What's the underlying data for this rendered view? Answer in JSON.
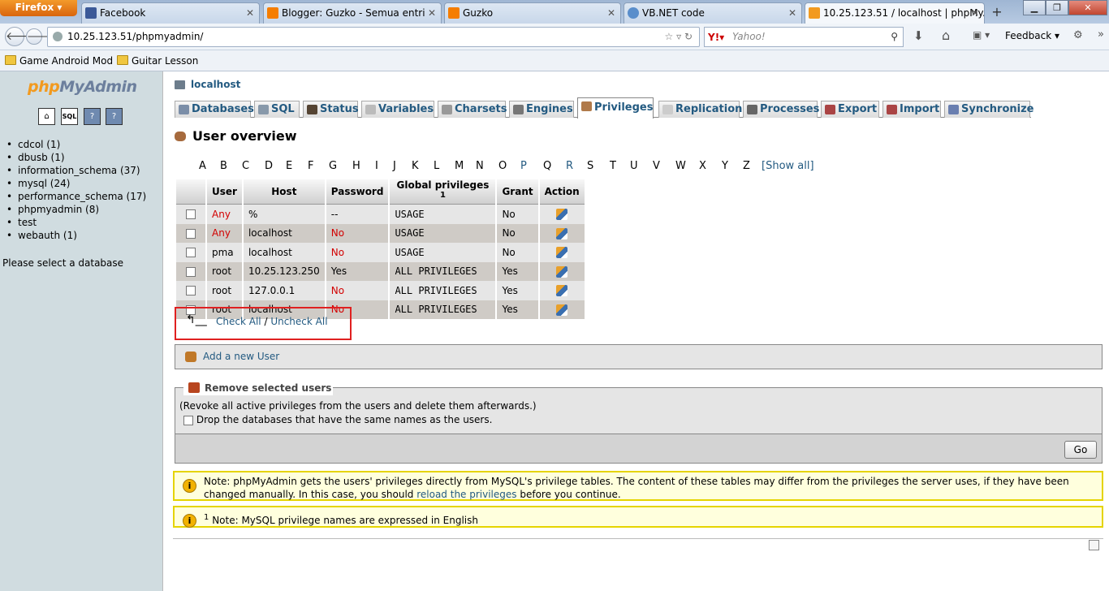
{
  "browser": {
    "firefox_label": "Firefox",
    "tabs": [
      {
        "title": "Facebook",
        "color": "#3b5998"
      },
      {
        "title": "Blogger: Guzko - Semua entri",
        "color": "#f57d00"
      },
      {
        "title": "Guzko",
        "color": "#f57d00"
      },
      {
        "title": "VB.NET code",
        "color": "#5a8ecb"
      },
      {
        "title": "10.25.123.51 / localhost | phpMy...",
        "color": "#f29a1f"
      }
    ],
    "new_tab": "+",
    "url": "10.25.123.51/phpmyadmin/",
    "search_placeholder": "Yahoo!",
    "feedback": "Feedback",
    "bookmarks": [
      "Game Android Mod",
      "Guitar Lesson"
    ]
  },
  "sidebar": {
    "logo_php": "php",
    "logo_myadmin": "MyAdmin",
    "icons": [
      "home-icon",
      "sql-icon",
      "help-icon",
      "docs-icon"
    ],
    "sql_icon_text": "SQL",
    "databases": [
      "cdcol (1)",
      "dbusb (1)",
      "information_schema (37)",
      "mysql (24)",
      "performance_schema (17)",
      "phpmyadmin (8)",
      "test",
      "webauth (1)"
    ],
    "select_db": "Please select a database"
  },
  "main": {
    "server": "localhost",
    "menu": [
      "Databases",
      "SQL",
      "Status",
      "Variables",
      "Charsets",
      "Engines",
      "Privileges",
      "Replication",
      "Processes",
      "Export",
      "Import",
      "Synchronize"
    ],
    "active_menu": "Privileges",
    "title": "User overview",
    "alphabet": [
      "A",
      "B",
      "C",
      "D",
      "E",
      "F",
      "G",
      "H",
      "I",
      "J",
      "K",
      "L",
      "M",
      "N",
      "O",
      "P",
      "Q",
      "R",
      "S",
      "T",
      "U",
      "V",
      "W",
      "X",
      "Y",
      "Z"
    ],
    "show_all": "[Show all]",
    "table_headers": [
      "User",
      "Host",
      "Password",
      "Global privileges",
      "Grant",
      "Action"
    ],
    "footnote_mark": "1",
    "users": [
      {
        "user": "Any",
        "host": "%",
        "password": "--",
        "privileges": "USAGE",
        "grant": "No"
      },
      {
        "user": "Any",
        "host": "localhost",
        "password": "No",
        "privileges": "USAGE",
        "grant": "No"
      },
      {
        "user": "pma",
        "host": "localhost",
        "password": "No",
        "privileges": "USAGE",
        "grant": "No"
      },
      {
        "user": "root",
        "host": "10.25.123.250",
        "password": "Yes",
        "privileges": "ALL PRIVILEGES",
        "grant": "Yes"
      },
      {
        "user": "root",
        "host": "127.0.0.1",
        "password": "No",
        "privileges": "ALL PRIVILEGES",
        "grant": "Yes"
      },
      {
        "user": "root",
        "host": "localhost",
        "password": "No",
        "privileges": "ALL PRIVILEGES",
        "grant": "Yes"
      }
    ],
    "check_all": "Check All",
    "separator": "/",
    "uncheck_all": "Uncheck All",
    "add_user": "Add a new User",
    "remove_legend": "Remove selected users",
    "remove_desc": "(Revoke all active privileges from the users and delete them afterwards.)",
    "drop_db_label": "Drop the databases that have the same names as the users.",
    "go": "Go",
    "note1_before": "Note: phpMyAdmin gets the users' privileges directly from MySQL's privilege tables. The content of these tables may differ from the privileges the server uses, if they have been changed manually. In this case, you should ",
    "note1_link": "reload the privileges",
    "note1_after": " before you continue.",
    "note2_sup": "1",
    "note2": " Note: MySQL privilege names are expressed in English"
  },
  "colors": {
    "link": "#235a81",
    "red_text": "#d20000",
    "highlight_box": "#e02020",
    "notice_border": "#e5d400"
  }
}
